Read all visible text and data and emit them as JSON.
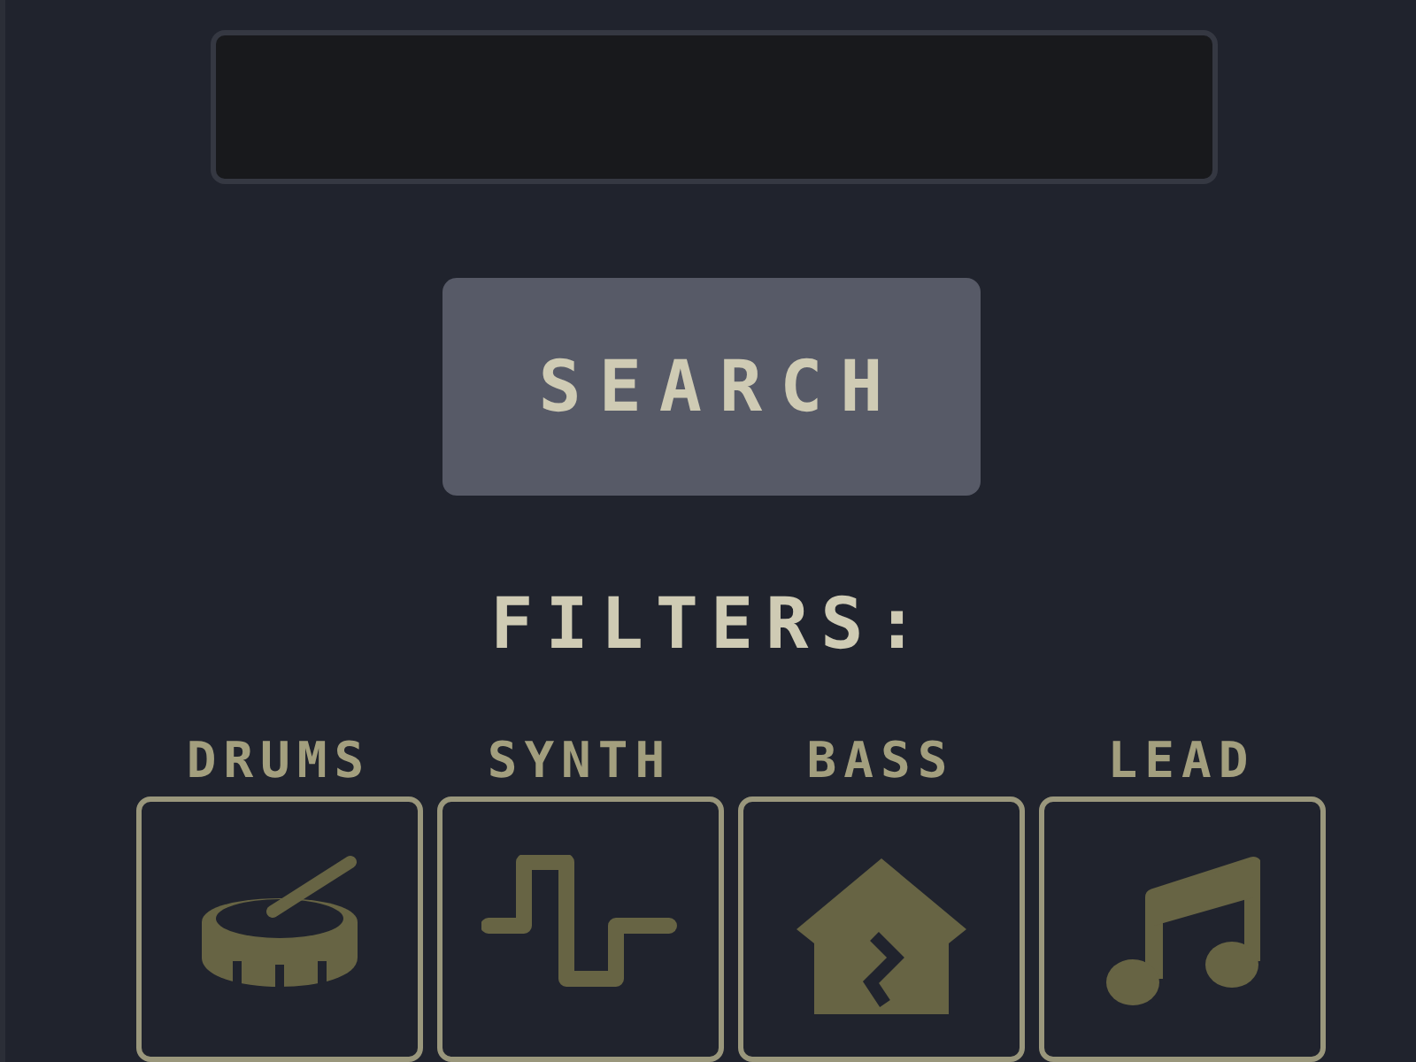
{
  "search": {
    "button": "SEARCH"
  },
  "filters": {
    "title": "FILTERS:",
    "items": [
      {
        "label": "DRUMS",
        "kind": "drum"
      },
      {
        "label": "SYNTH",
        "kind": "wave"
      },
      {
        "label": "BASS",
        "kind": "house"
      },
      {
        "label": "LEAD",
        "kind": "note"
      }
    ]
  }
}
